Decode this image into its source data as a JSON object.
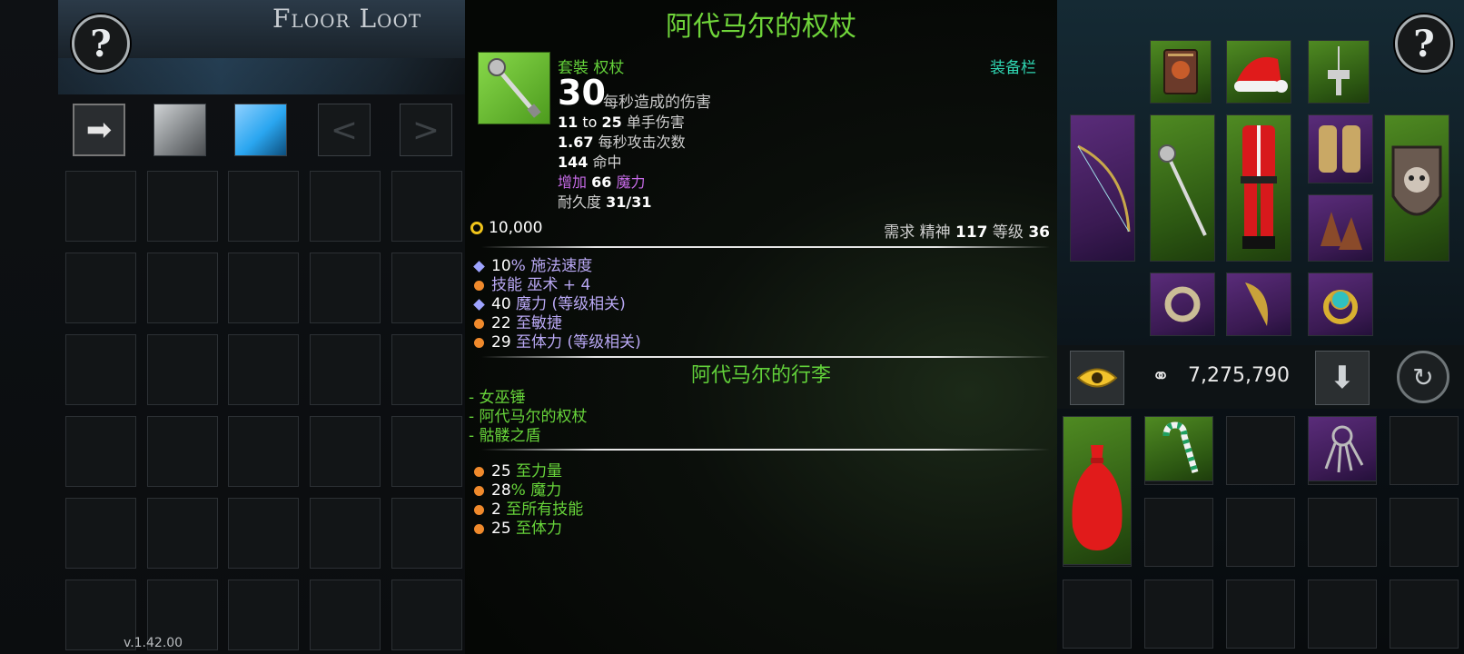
{
  "left_panel": {
    "help_label": "?",
    "title": "Floor Loot",
    "filter_arrow_icon": "arrow-right-icon",
    "prev_label": "<",
    "next_label": ">",
    "version": "v.1.42.00"
  },
  "tooltip": {
    "item_name": "阿代马尔的权杖",
    "item_type": "套裝 权杖",
    "equip_label": "装备栏",
    "dps_value": "30",
    "dps_label": "每秒造成的伤害",
    "damage_min": "11",
    "damage_to": "to",
    "damage_max": "25",
    "damage_label": "单手伤害",
    "attack_speed": "1.67",
    "attack_speed_label": "每秒攻击次数",
    "accuracy": "144",
    "accuracy_label": "命中",
    "mana_prefix": "增加",
    "mana_value": "66",
    "mana_label": "魔力",
    "durability_label": "耐久度",
    "durability": "31/31",
    "gold_value": "10,000",
    "require_label": "需求 精神",
    "require_spirit": "117",
    "require_level_label": "等级",
    "require_level": "36",
    "affixes": [
      {
        "value": "10",
        "suffix": "%",
        "text": "施法速度",
        "extra": ""
      },
      {
        "value": "",
        "suffix": "技能 巫术 + 4",
        "text": "",
        "extra": ""
      },
      {
        "value": "40",
        "suffix": "",
        "text": "魔力",
        "extra": "(等级相关)"
      },
      {
        "value": "22",
        "suffix": "",
        "text": "至敏捷",
        "extra": ""
      },
      {
        "value": "29",
        "suffix": "",
        "text": "至体力",
        "extra": "(等级相关)"
      }
    ],
    "set_name": "阿代马尔的行李",
    "set_items": [
      "- 女巫锤",
      "- 阿代马尔的权杖",
      "- 骷髅之盾"
    ],
    "set_bonuses": [
      {
        "value": "25",
        "suffix": "",
        "text": "至力量"
      },
      {
        "value": "28",
        "suffix": "%",
        "text": "魔力"
      },
      {
        "value": "2",
        "suffix": "",
        "text": "至所有技能"
      },
      {
        "value": "25",
        "suffix": "",
        "text": "至体力"
      }
    ]
  },
  "right_panel": {
    "help_label": "?",
    "gold_total": "7,275,790",
    "equipment_icons": {
      "tome": "book-icon",
      "hat": "santa-hat-icon",
      "amulet": "hammer-amulet-icon",
      "bow": "bow-icon",
      "scepter": "scepter-icon",
      "armor": "santa-suit-icon",
      "gloves": "gloves-icon",
      "boots": "sandals-icon",
      "shield": "skull-shield-icon",
      "ring_left": "ring-icon",
      "horn": "horn-icon",
      "ring_right": "gem-ring-icon"
    },
    "inventory_icons": {
      "bag": "red-sack-icon",
      "candy_cane": "candy-cane-icon",
      "keys": "key-ring-icon"
    }
  },
  "colors": {
    "set_green": "#67d43a",
    "magic_purple": "#c76be8",
    "teal": "#2fd6b2",
    "gold": "#f0c41b"
  }
}
